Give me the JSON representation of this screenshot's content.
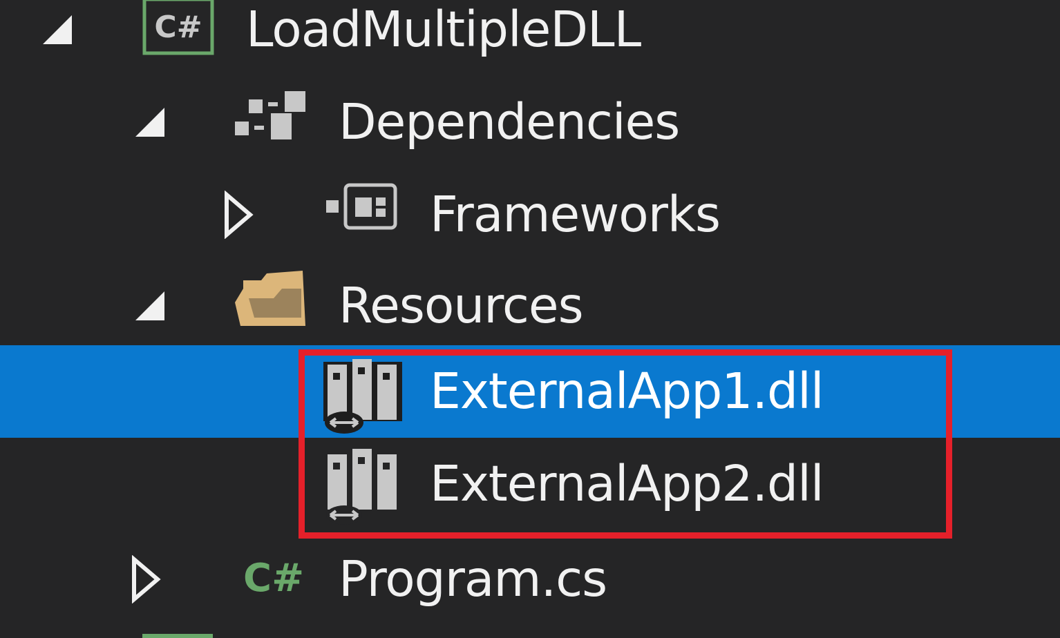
{
  "solution_explorer": {
    "items": [
      {
        "label": "LoadMultipleDLL",
        "icon": "csharp-project-icon",
        "expanded": true
      },
      {
        "label": "Dependencies",
        "icon": "dependencies-icon",
        "expanded": true
      },
      {
        "label": "Frameworks",
        "icon": "frameworks-icon",
        "expanded": false
      },
      {
        "label": "Resources",
        "icon": "folder-icon",
        "expanded": true
      },
      {
        "label": "ExternalApp1.dll",
        "icon": "dll-reference-icon",
        "selected": true
      },
      {
        "label": "ExternalApp2.dll",
        "icon": "dll-reference-icon"
      },
      {
        "label": "Program.cs",
        "icon": "csharp-file-icon",
        "expanded": false
      }
    ],
    "project_icon_text": "C#",
    "file_icon_text": "C#"
  },
  "colors": {
    "background": "#252526",
    "selection": "#0a79cf",
    "highlight_border": "#e5202a",
    "csharp_green": "#6aa86a",
    "folder": "#dcb67a"
  }
}
